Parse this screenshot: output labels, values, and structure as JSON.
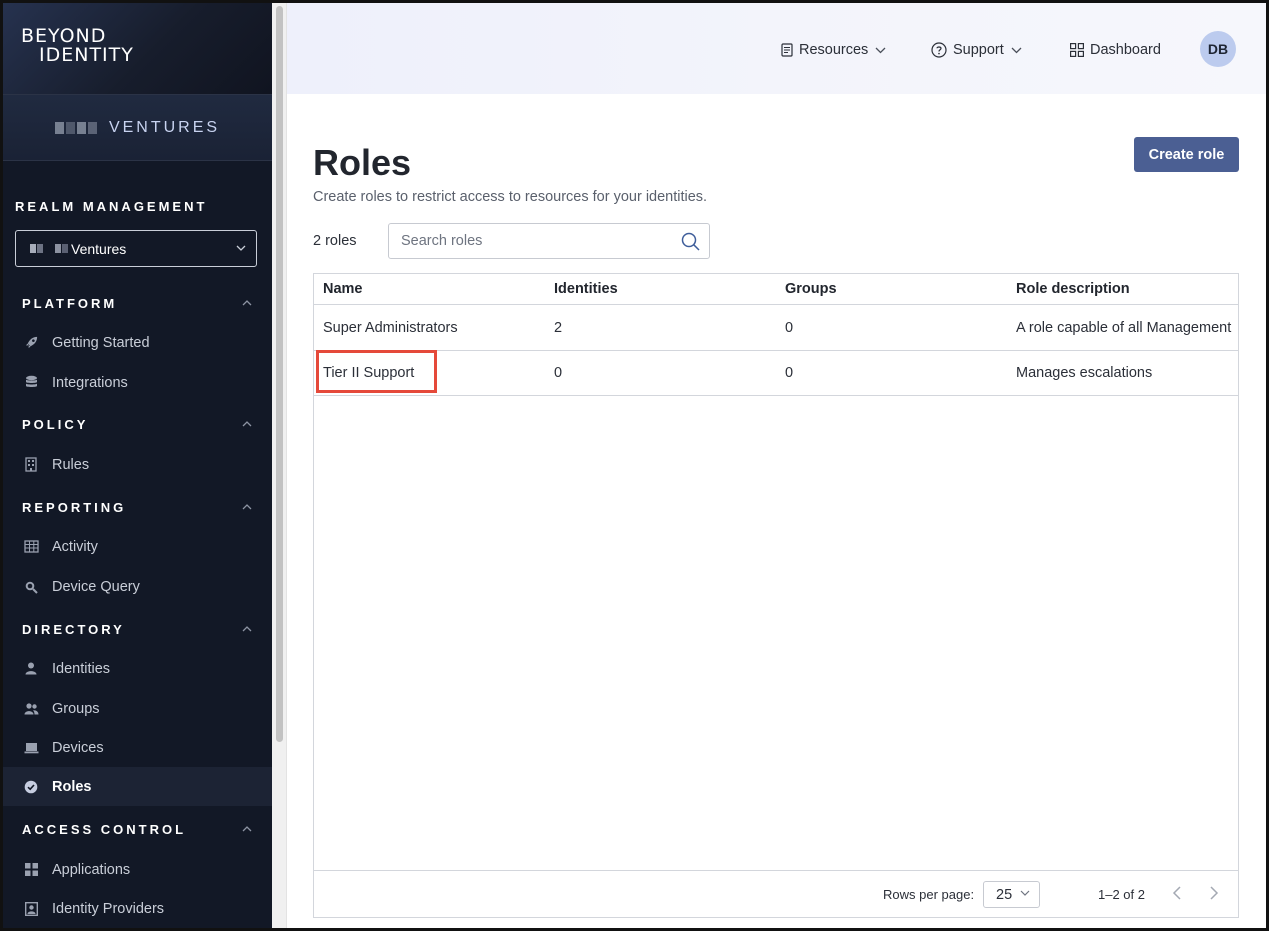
{
  "brand": {
    "line1": "BEYOND",
    "line2": "IDENTITY"
  },
  "tenant": {
    "name": "VENTURES"
  },
  "realm": {
    "title": "REALM MANAGEMENT",
    "selected": "Ventures"
  },
  "sidebar": {
    "sections": [
      {
        "title": "PLATFORM",
        "items": [
          {
            "label": "Getting Started",
            "icon": "rocket-icon"
          },
          {
            "label": "Integrations",
            "icon": "database-icon"
          }
        ]
      },
      {
        "title": "POLICY",
        "items": [
          {
            "label": "Rules",
            "icon": "building-icon"
          }
        ]
      },
      {
        "title": "REPORTING",
        "items": [
          {
            "label": "Activity",
            "icon": "table-icon"
          },
          {
            "label": "Device Query",
            "icon": "search-icon"
          }
        ]
      },
      {
        "title": "DIRECTORY",
        "items": [
          {
            "label": "Identities",
            "icon": "user-icon"
          },
          {
            "label": "Groups",
            "icon": "users-icon"
          },
          {
            "label": "Devices",
            "icon": "laptop-icon"
          },
          {
            "label": "Roles",
            "icon": "badge-check-icon",
            "active": true
          }
        ]
      },
      {
        "title": "ACCESS CONTROL",
        "items": [
          {
            "label": "Applications",
            "icon": "grid-icon"
          },
          {
            "label": "Identity Providers",
            "icon": "id-card-icon"
          }
        ]
      }
    ]
  },
  "header": {
    "resources": "Resources",
    "support": "Support",
    "dashboard": "Dashboard",
    "avatar": "DB"
  },
  "main": {
    "title": "Roles",
    "subtitle": "Create roles to restrict access to resources for your identities.",
    "create_button": "Create role",
    "count": "2 roles",
    "search_placeholder": "Search roles",
    "columns": [
      "Name",
      "Identities",
      "Groups",
      "Role description"
    ],
    "rows": [
      {
        "name": "Super Administrators",
        "identities": "2",
        "groups": "0",
        "description": "A role capable of all Management"
      },
      {
        "name": "Tier II Support",
        "identities": "0",
        "groups": "0",
        "description": "Manages escalations"
      }
    ],
    "footer": {
      "rows_per_page_label": "Rows per page:",
      "rows_per_page": "25",
      "range": "1–2 of 2"
    }
  },
  "colors": {
    "sidebar_bg": "#121826",
    "accent_button": "#4b5f93",
    "highlight": "#e5493a",
    "avatar_bg": "#bccbee"
  }
}
